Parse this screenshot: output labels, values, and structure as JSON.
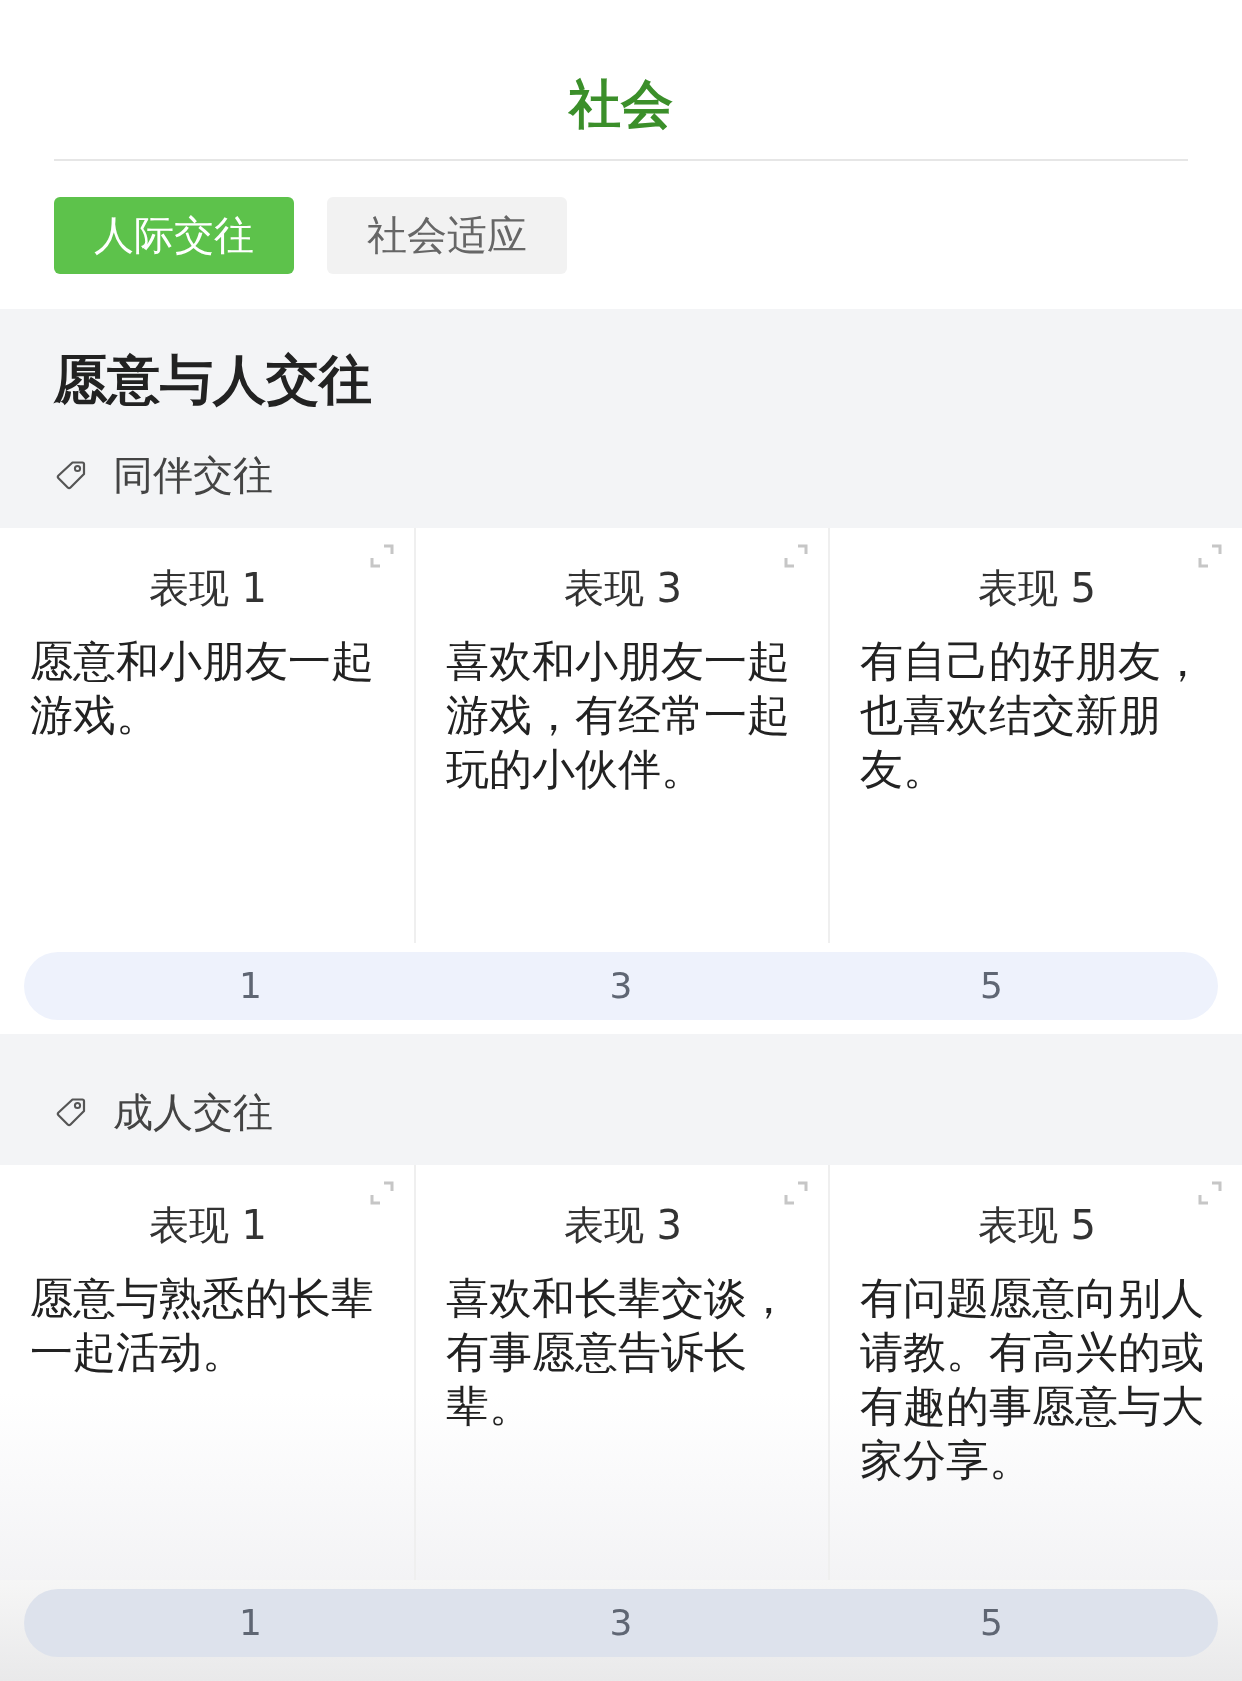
{
  "title": "社会",
  "tabs": [
    {
      "label": "人际交往",
      "selected": true
    },
    {
      "label": "社会适应",
      "selected": false
    }
  ],
  "section": {
    "heading": "愿意与人交往",
    "groups": [
      {
        "tag": "同伴交往",
        "cards": [
          {
            "title": "表现 1",
            "text": "愿意和小朋友一起游戏。"
          },
          {
            "title": "表现 3",
            "text": "喜欢和小朋友一起游戏，有经常一起玩的小伙伴。"
          },
          {
            "title": "表现 5",
            "text": "有自己的好朋友，也喜欢结交新朋友。"
          }
        ],
        "scale": [
          "1",
          "3",
          "5"
        ]
      },
      {
        "tag": "成人交往",
        "cards": [
          {
            "title": "表现 1",
            "text": "愿意与熟悉的长辈一起活动。"
          },
          {
            "title": "表现 3",
            "text": "喜欢和长辈交谈，有事愿意告诉长辈。"
          },
          {
            "title": "表现 5",
            "text": "有问题愿意向别人请教。有高兴的或有趣的事愿意与大家分享。"
          }
        ],
        "scale": [
          "1",
          "3",
          "5"
        ]
      }
    ]
  }
}
